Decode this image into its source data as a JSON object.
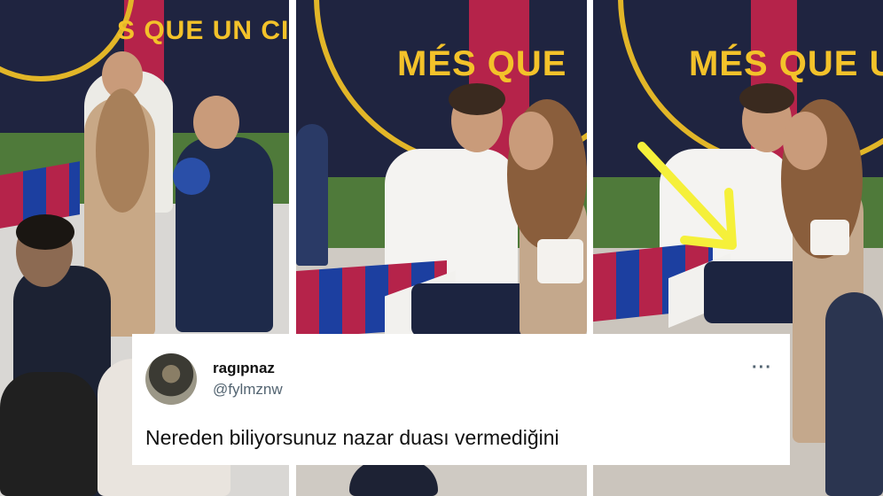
{
  "scene": {
    "banner_text_1": "S QUE UN CI",
    "banner_text_2": "MÉS QUE",
    "banner_text_3": "MÉS QUE U",
    "colors": {
      "wall": "#1f2440",
      "stripe": "#b5234a",
      "banner_gold": "#f3c22a",
      "arrow": "#f5f03a"
    }
  },
  "tweet": {
    "display_name": "ragıpnaz",
    "handle": "@fylmznw",
    "more_icon": "···",
    "text": "Nereden biliyorsunuz nazar duası vermediğini"
  }
}
